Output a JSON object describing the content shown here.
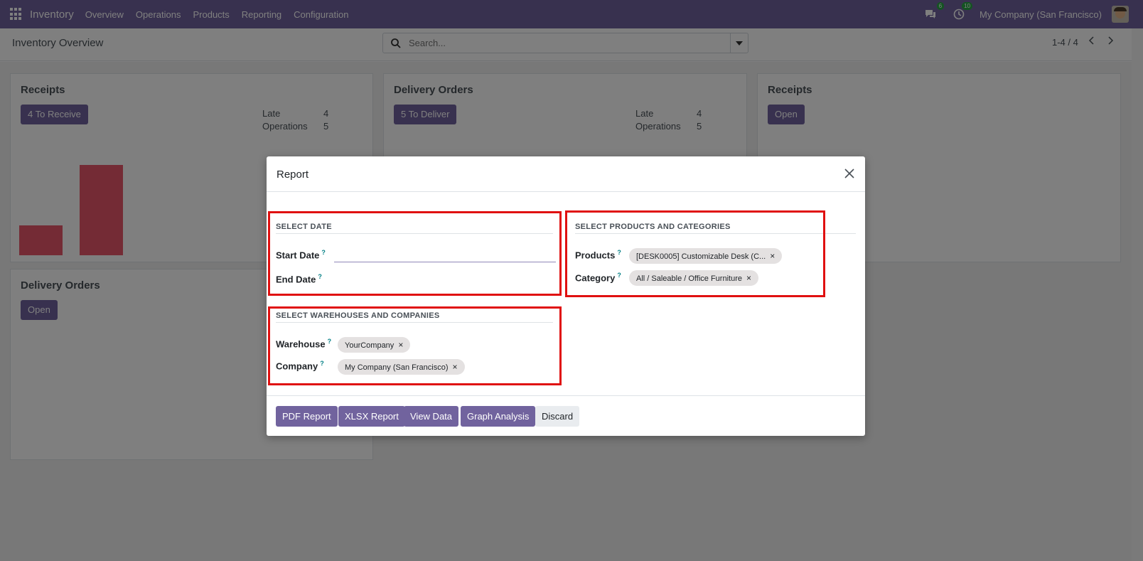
{
  "navbar": {
    "app_name": "Inventory",
    "menu": [
      "Overview",
      "Operations",
      "Products",
      "Reporting",
      "Configuration"
    ],
    "messages_count": "6",
    "activities_count": "10",
    "company": "My Company (San Francisco)"
  },
  "control_panel": {
    "title": "Inventory Overview",
    "search_placeholder": "Search...",
    "pager": "1-4 / 4"
  },
  "cards": {
    "receipts_1": {
      "title": "Receipts",
      "button": "4 To Receive",
      "late_label": "Late",
      "late_value": "4",
      "ops_label": "Operations",
      "ops_value": "5"
    },
    "delivery_1": {
      "title": "Delivery Orders",
      "button": "5 To Deliver",
      "late_label": "Late",
      "late_value": "4",
      "ops_label": "Operations",
      "ops_value": "5"
    },
    "receipts_2": {
      "title": "Receipts",
      "button": "Open"
    },
    "delivery_2": {
      "title": "Delivery Orders",
      "button": "Open"
    }
  },
  "modal": {
    "title": "Report",
    "date_section": {
      "title": "SELECT DATE",
      "start_label": "Start Date",
      "end_label": "End Date",
      "start_value": "",
      "end_value": ""
    },
    "products_section": {
      "title": "SELECT PRODUCTS AND CATEGORIES",
      "products_label": "Products",
      "products_tag": "[DESK0005] Customizable Desk (C...",
      "category_label": "Category",
      "category_tag": "All / Saleable / Office Furniture"
    },
    "warehouse_section": {
      "title": "SELECT WAREHOUSES AND COMPANIES",
      "warehouse_label": "Warehouse",
      "warehouse_tag": "YourCompany",
      "company_label": "Company",
      "company_tag": "My Company (San Francisco)"
    },
    "help_mark": "?",
    "remove_mark": "×",
    "buttons": {
      "pdf": "PDF Report",
      "xlsx": "XLSX Report",
      "view": "View Data",
      "graph": "Graph Analysis",
      "discard": "Discard"
    }
  },
  "colors": {
    "brand": "#71639e",
    "highlight": "#e01010",
    "bar": "#e8576a",
    "badge": "#28a745"
  }
}
